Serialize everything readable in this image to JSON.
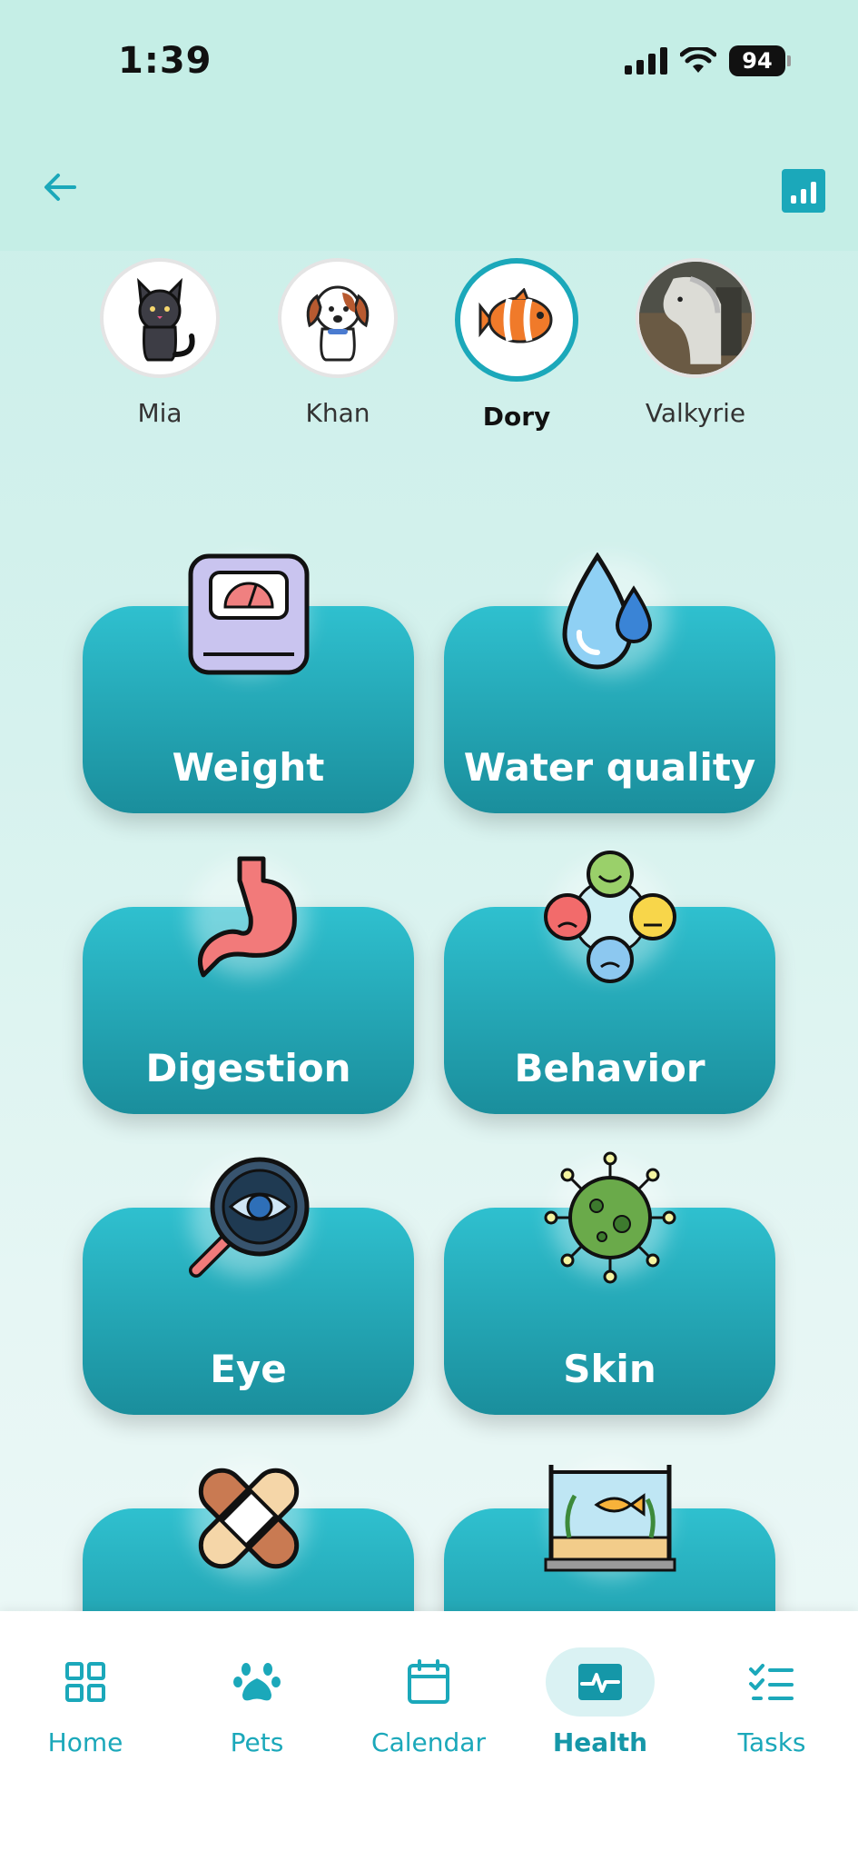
{
  "status_bar": {
    "time": "1:39",
    "battery": "94"
  },
  "header": {
    "back_icon": "arrow-left-icon",
    "stats_icon": "bar-chart-icon"
  },
  "pets": [
    {
      "name": "Mia",
      "icon": "cat-icon",
      "selected": false
    },
    {
      "name": "Khan",
      "icon": "dog-icon",
      "selected": false
    },
    {
      "name": "Dory",
      "icon": "clownfish-icon",
      "selected": true
    },
    {
      "name": "Valkyrie",
      "icon": "horse-photo",
      "selected": false
    }
  ],
  "categories": [
    {
      "label": "Weight",
      "icon": "scale-icon"
    },
    {
      "label": "Water quality",
      "icon": "water-drop-icon"
    },
    {
      "label": "Digestion",
      "icon": "stomach-icon"
    },
    {
      "label": "Behavior",
      "icon": "emotions-icon"
    },
    {
      "label": "Eye",
      "icon": "eye-magnifier-icon"
    },
    {
      "label": "Skin",
      "icon": "virus-icon"
    },
    {
      "label": "",
      "icon": "bandage-icon"
    },
    {
      "label": "",
      "icon": "aquarium-icon"
    }
  ],
  "nav": {
    "items": [
      {
        "label": "Home",
        "icon": "grid-icon"
      },
      {
        "label": "Pets",
        "icon": "paw-icon"
      },
      {
        "label": "Calendar",
        "icon": "calendar-icon"
      },
      {
        "label": "Health",
        "icon": "heartbeat-icon",
        "active": true
      },
      {
        "label": "Tasks",
        "icon": "checklist-icon"
      }
    ]
  },
  "colors": {
    "accent": "#1ba8ba",
    "card_top": "#2fc0cf",
    "card_bottom": "#1a8e9c"
  }
}
